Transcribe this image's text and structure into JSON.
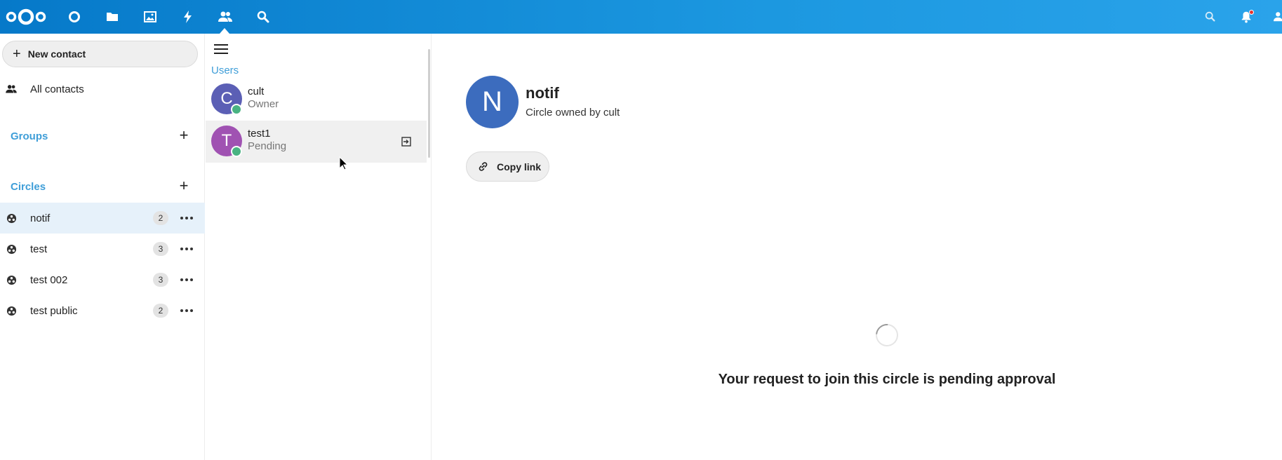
{
  "header": {
    "logo": "nextcloud-logo",
    "apps": [
      {
        "name": "dashboard-icon"
      },
      {
        "name": "files-icon"
      },
      {
        "name": "photos-icon"
      },
      {
        "name": "activity-icon"
      },
      {
        "name": "contacts-icon",
        "active": true
      },
      {
        "name": "circles-search-icon"
      }
    ],
    "right": [
      "search-icon",
      "notifications-icon",
      "settings-icon"
    ]
  },
  "nav": {
    "new_contact_label": "New contact",
    "all_contacts_label": "All contacts",
    "groups_label": "Groups",
    "circles_label": "Circles",
    "circles": [
      {
        "label": "notif",
        "count": "2",
        "active": true
      },
      {
        "label": "test",
        "count": "3"
      },
      {
        "label": "test 002",
        "count": "3"
      },
      {
        "label": "test public",
        "count": "2"
      }
    ]
  },
  "members": {
    "group_label": "Users",
    "items": [
      {
        "initial": "C",
        "name": "cult",
        "role": "Owner",
        "color": "#5b5fb5"
      },
      {
        "initial": "T",
        "name": "test1",
        "role": "Pending",
        "color": "#a052b2"
      }
    ]
  },
  "details": {
    "initial": "N",
    "name": "notif",
    "owner_text": "Circle owned by cult",
    "copy_link_label": "Copy link",
    "pending_message": "Your request to join this circle is pending approval"
  },
  "colors": {
    "header": "#0679c9",
    "accent": "#3f9ed8",
    "avatar_main": "#3c6cbe",
    "status_online": "#49b382"
  }
}
